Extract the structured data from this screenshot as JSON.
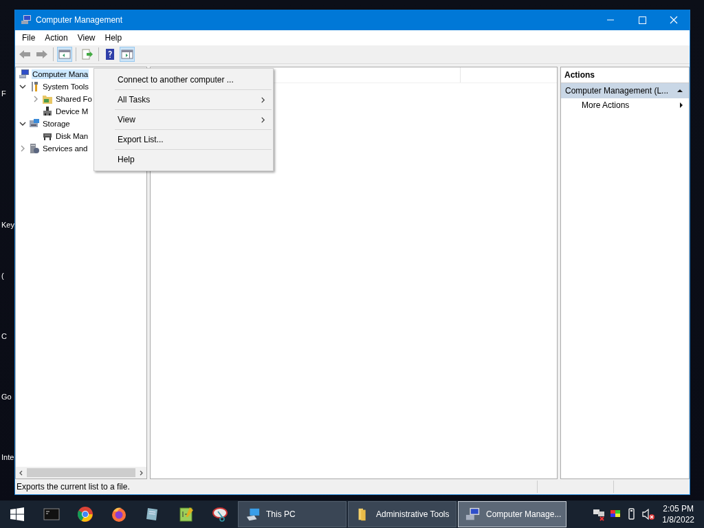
{
  "desktop_labels": [
    {
      "text": "F"
    },
    {
      "text": "Key"
    },
    {
      "text": "("
    },
    {
      "text": "C"
    },
    {
      "text": "Go"
    },
    {
      "text": "Inte"
    }
  ],
  "window": {
    "title": "Computer Management"
  },
  "menu_bar": [
    "File",
    "Action",
    "View",
    "Help"
  ],
  "toolbar": [
    {
      "kind": "back",
      "pressed": false
    },
    {
      "kind": "forward",
      "pressed": false
    },
    {
      "kind": "tree",
      "pressed": true
    },
    {
      "kind": "export",
      "pressed": false
    },
    {
      "kind": "help",
      "pressed": false
    },
    {
      "kind": "pane",
      "pressed": true
    }
  ],
  "tree": [
    {
      "label": "Computer Mana",
      "kind": "computer",
      "selected": true,
      "children": [
        {
          "label": "System Tools",
          "kind": "tools",
          "selected": false,
          "expanded": true,
          "children": [
            {
              "label": "Shared Fo",
              "kind": "share",
              "selected": false,
              "expanded": false
            },
            {
              "label": "Device M",
              "kind": "device",
              "selected": false
            }
          ]
        },
        {
          "label": "Storage",
          "kind": "storage",
          "selected": false,
          "expanded": true,
          "children": [
            {
              "label": "Disk Man",
              "kind": "disk",
              "selected": false
            }
          ]
        },
        {
          "label": "Services and",
          "kind": "services",
          "selected": false,
          "expanded": false
        }
      ]
    }
  ],
  "context_menu": [
    {
      "label": "Connect to another computer ...",
      "submenu": false
    },
    {
      "label": "All Tasks",
      "submenu": true
    },
    {
      "label": "View",
      "submenu": true
    },
    {
      "label": "Export List...",
      "submenu": false
    },
    {
      "label": "Help",
      "submenu": false
    }
  ],
  "actions": {
    "title": "Actions",
    "group": "Computer Management (L...",
    "items": [
      {
        "label": "More Actions",
        "submenu": true
      }
    ]
  },
  "status_bar": "Exports the current list to a file.",
  "taskbar": {
    "pinned": [
      {
        "kind": "terminal"
      },
      {
        "kind": "chrome"
      },
      {
        "kind": "firefox"
      },
      {
        "kind": "notepad"
      },
      {
        "kind": "notepadpp"
      },
      {
        "kind": "snip"
      }
    ],
    "windows": [
      {
        "label": "This PC",
        "kind": "pc",
        "selected": false
      },
      {
        "label": "Administrative Tools",
        "kind": "folder",
        "selected": false
      },
      {
        "label": "Computer Manage...",
        "kind": "computer",
        "selected": true
      }
    ],
    "time": "2:05 PM",
    "date": "1/8/2022"
  }
}
